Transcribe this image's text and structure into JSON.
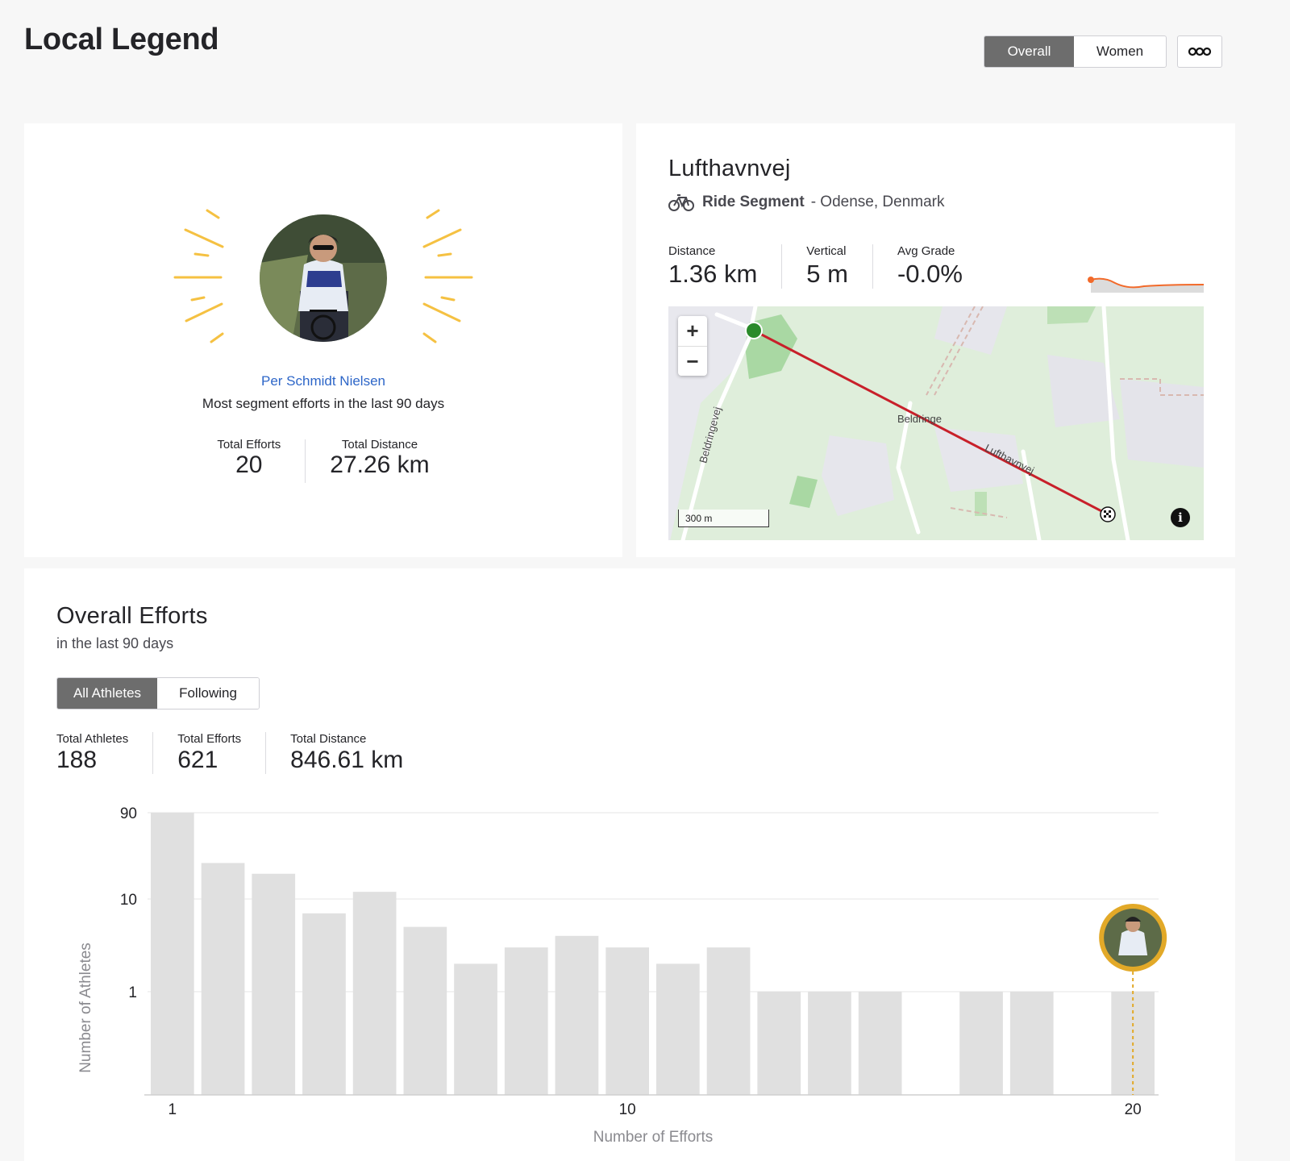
{
  "header": {
    "title": "Local Legend",
    "tabs": [
      "Overall",
      "Women"
    ],
    "active_tab": "Overall",
    "more_icon": "ellipsis-icon"
  },
  "legend": {
    "athlete_name": "Per Schmidt Nielsen",
    "subtitle": "Most segment efforts in the last 90 days",
    "stats": [
      {
        "label": "Total Efforts",
        "value": "20"
      },
      {
        "label": "Total Distance",
        "value": "27.26 km"
      }
    ],
    "ray_color": "#f5c142"
  },
  "segment": {
    "name": "Lufthavnvej",
    "type_label": "Ride Segment",
    "location": "- Odense, Denmark",
    "stats": [
      {
        "label": "Distance",
        "value": "1.36 km"
      },
      {
        "label": "Vertical",
        "value": "5 m"
      },
      {
        "label": "Avg Grade",
        "value": "-0.0%"
      }
    ],
    "map": {
      "zoom_in": "+",
      "zoom_out": "−",
      "scale_label": "300 m",
      "labels": [
        "Beldringe",
        "Lufthavnvej",
        "Beldringevej"
      ],
      "info_icon": "i",
      "route_color": "#c8202a"
    }
  },
  "efforts": {
    "title": "Overall Efforts",
    "subtitle": "in the last 90 days",
    "filters": [
      "All Athletes",
      "Following"
    ],
    "active_filter": "All Athletes",
    "stats": [
      {
        "label": "Total Athletes",
        "value": "188"
      },
      {
        "label": "Total Efforts",
        "value": "621"
      },
      {
        "label": "Total Distance",
        "value": "846.61 km"
      }
    ]
  },
  "chart_data": {
    "type": "bar",
    "xlabel": "Number of Efforts",
    "ylabel": "Number of Athletes",
    "y_scale": "log",
    "y_ticks": [
      "90",
      "10",
      "1"
    ],
    "x_ticks": [
      "1",
      "10",
      "20"
    ],
    "categories": [
      1,
      2,
      3,
      4,
      5,
      6,
      7,
      8,
      9,
      10,
      11,
      12,
      13,
      14,
      15,
      16,
      17,
      18,
      19,
      20
    ],
    "values": [
      90,
      25,
      19,
      7,
      12,
      5,
      2,
      3,
      4,
      3,
      2,
      3,
      1,
      1,
      1,
      0,
      1,
      1,
      0,
      1
    ],
    "highlight_category": 20,
    "bar_color": "#e0e0e0",
    "highlight_color": "#e2a928",
    "grid": true
  }
}
